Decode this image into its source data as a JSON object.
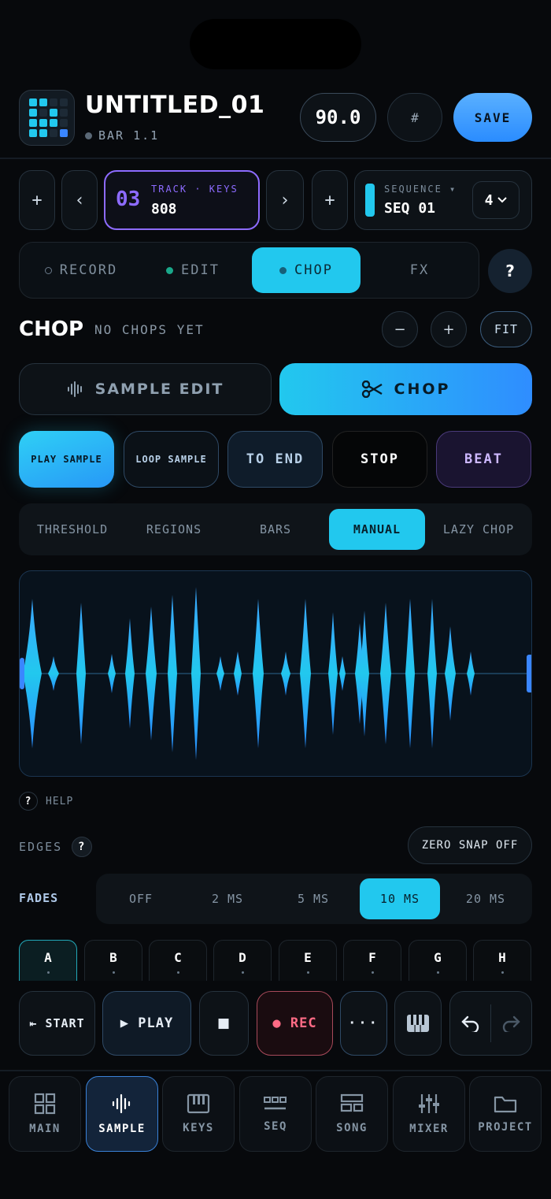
{
  "header": {
    "project_title": "UNTITLED_01",
    "bar_position": "BAR 1.1",
    "tempo": "90.0",
    "hash_label": "#",
    "save_label": "SAVE"
  },
  "track": {
    "add_left": "+",
    "prev": "‹",
    "number": "03",
    "label": "TRACK · KEYS",
    "name": "808",
    "next": "›",
    "add_right": "+"
  },
  "sequence": {
    "label": "SEQUENCE ▾",
    "name": "SEQ 01",
    "count": "4"
  },
  "modes": {
    "items": [
      {
        "label": "RECORD"
      },
      {
        "label": "EDIT"
      },
      {
        "label": "CHOP"
      },
      {
        "label": "FX"
      }
    ],
    "active": "CHOP",
    "help": "?"
  },
  "chop": {
    "heading": "CHOP",
    "status": "NO CHOPS YET",
    "zoom_out": "−",
    "zoom_in": "+",
    "fit": "FIT",
    "sample_edit": "SAMPLE EDIT",
    "chop_button": "CHOP"
  },
  "playback": {
    "play_sample": "PLAY SAMPLE",
    "loop_sample": "LOOP SAMPLE",
    "to_end": "TO END",
    "stop": "STOP",
    "beat": "BEAT"
  },
  "chop_modes": {
    "items": [
      "THRESHOLD",
      "REGIONS",
      "BARS",
      "MANUAL",
      "LAZY CHOP"
    ],
    "active": "MANUAL"
  },
  "help": {
    "label": "HELP",
    "icon": "?"
  },
  "edges": {
    "label": "EDGES",
    "icon": "?",
    "zero_snap": "ZERO SNAP OFF"
  },
  "fades": {
    "label": "FADES",
    "options": [
      "OFF",
      "2 MS",
      "5 MS",
      "10 MS",
      "20 MS"
    ],
    "active": "10 MS"
  },
  "pads": {
    "items": [
      "A",
      "B",
      "C",
      "D",
      "E",
      "F",
      "G",
      "H"
    ],
    "active": "A"
  },
  "transport": {
    "start": "⇤ START",
    "play": "▶ PLAY",
    "stop": "■",
    "rec": "● REC",
    "more": "···"
  },
  "nav": {
    "items": [
      "MAIN",
      "SAMPLE",
      "KEYS",
      "SEQ",
      "SONG",
      "MIXER",
      "PROJECT"
    ],
    "active": "SAMPLE"
  },
  "colors": {
    "accent": "#22c8ee",
    "track_purple": "#8d6bff",
    "rec_red": "#ff6b85",
    "save_blue": "#3a8cff"
  }
}
